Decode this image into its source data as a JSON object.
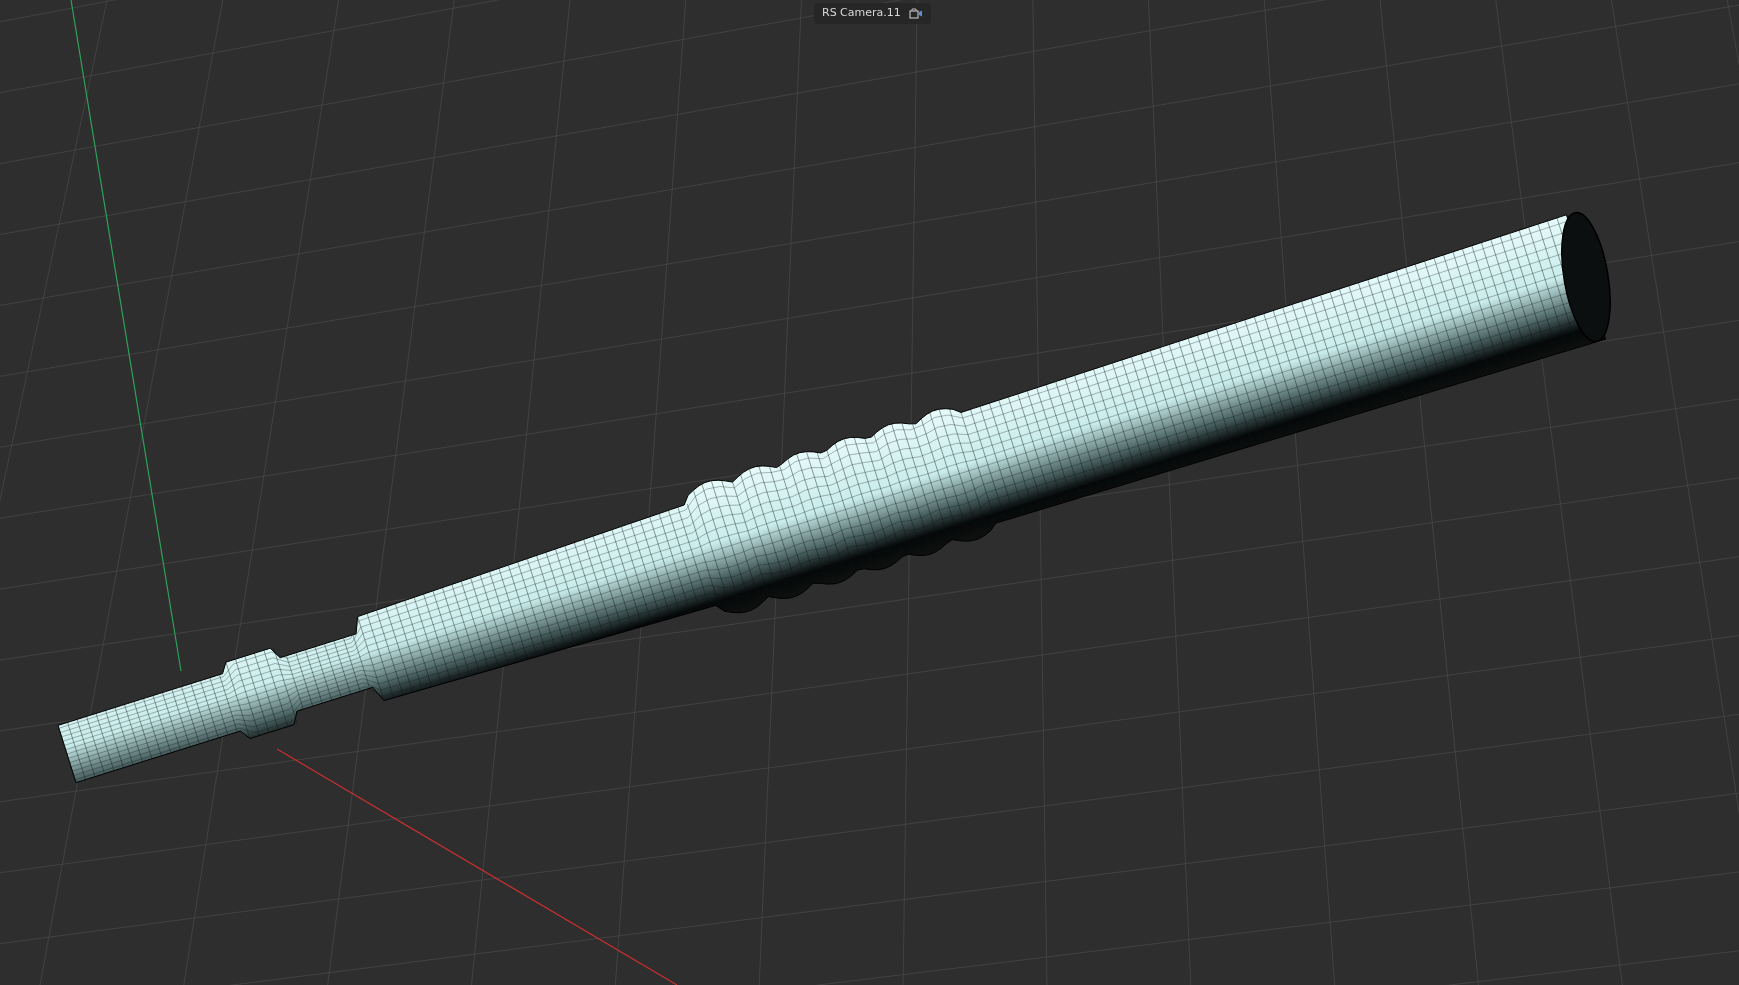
{
  "viewport": {
    "camera_label": "RS Camera.11"
  }
}
